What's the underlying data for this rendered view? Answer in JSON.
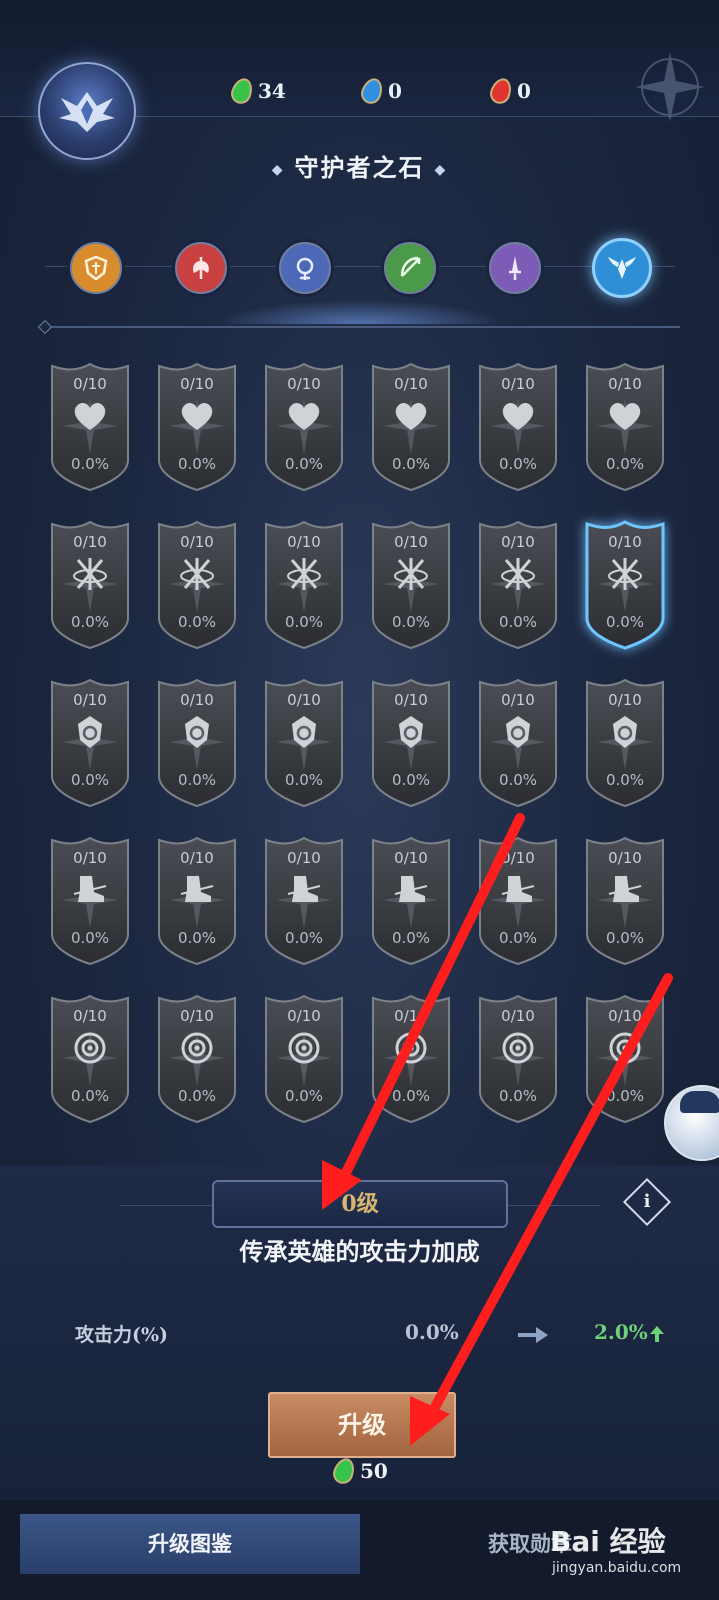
{
  "header": {
    "currencies": [
      {
        "icon": "green-gem-icon",
        "color": "#37c24a",
        "value": "34"
      },
      {
        "icon": "blue-gem-icon",
        "color": "#2f8fe0",
        "value": "0"
      },
      {
        "icon": "red-gem-icon",
        "color": "#e0352f",
        "value": "0"
      }
    ],
    "title": "守护者之石"
  },
  "class_tabs": [
    {
      "icon": "shield-class-icon",
      "color": "#d98c2c"
    },
    {
      "icon": "axe-class-icon",
      "color": "#c94040"
    },
    {
      "icon": "mage-class-icon",
      "color": "#4e68b8"
    },
    {
      "icon": "bow-class-icon",
      "color": "#4a9a4a"
    },
    {
      "icon": "dagger-class-icon",
      "color": "#7d5cb8"
    },
    {
      "icon": "wings-class-icon",
      "color": "#2e8fd6",
      "active": true
    }
  ],
  "grid": {
    "rows": [
      {
        "icon": "heart-icon",
        "cells": [
          {
            "level": "0/10",
            "percent": "0.0%"
          },
          {
            "level": "0/10",
            "percent": "0.0%"
          },
          {
            "level": "0/10",
            "percent": "0.0%"
          },
          {
            "level": "0/10",
            "percent": "0.0%"
          },
          {
            "level": "0/10",
            "percent": "0.0%"
          },
          {
            "level": "0/10",
            "percent": "0.0%"
          }
        ]
      },
      {
        "icon": "crossed-swords-icon",
        "cells": [
          {
            "level": "0/10",
            "percent": "0.0%"
          },
          {
            "level": "0/10",
            "percent": "0.0%"
          },
          {
            "level": "0/10",
            "percent": "0.0%"
          },
          {
            "level": "0/10",
            "percent": "0.0%"
          },
          {
            "level": "0/10",
            "percent": "0.0%"
          },
          {
            "level": "0/10",
            "percent": "0.0%",
            "selected": true
          }
        ]
      },
      {
        "icon": "crest-icon",
        "cells": [
          {
            "level": "0/10",
            "percent": "0.0%"
          },
          {
            "level": "0/10",
            "percent": "0.0%"
          },
          {
            "level": "0/10",
            "percent": "0.0%"
          },
          {
            "level": "0/10",
            "percent": "0.0%"
          },
          {
            "level": "0/10",
            "percent": "0.0%"
          },
          {
            "level": "0/10",
            "percent": "0.0%"
          }
        ]
      },
      {
        "icon": "boot-icon",
        "cells": [
          {
            "level": "0/10",
            "percent": "0.0%"
          },
          {
            "level": "0/10",
            "percent": "0.0%"
          },
          {
            "level": "0/10",
            "percent": "0.0%"
          },
          {
            "level": "0/10",
            "percent": "0.0%"
          },
          {
            "level": "0/10",
            "percent": "0.0%"
          },
          {
            "level": "0/10",
            "percent": "0.0%"
          }
        ]
      },
      {
        "icon": "target-icon",
        "cells": [
          {
            "level": "0/10",
            "percent": "0.0%"
          },
          {
            "level": "0/10",
            "percent": "0.0%"
          },
          {
            "level": "0/10",
            "percent": "0.0%"
          },
          {
            "level": "0/10",
            "percent": "0.0%"
          },
          {
            "level": "0/10",
            "percent": "0.0%"
          },
          {
            "level": "0/10",
            "percent": "0.0%"
          }
        ]
      }
    ]
  },
  "detail": {
    "level_label": "0级",
    "description": "传承英雄的攻击力加成",
    "info_label": "i",
    "stat": {
      "label": "攻击力(%)",
      "from": "0.0%",
      "to": "2.0%"
    },
    "upgrade_label": "升级",
    "cost": "50"
  },
  "bottom_tabs": [
    {
      "label": "升级图鉴",
      "active": true
    },
    {
      "label": "获取勋章",
      "active": false
    }
  ],
  "watermark": {
    "main": "Bai 经验",
    "sub": "jingyan.baidu.com"
  }
}
